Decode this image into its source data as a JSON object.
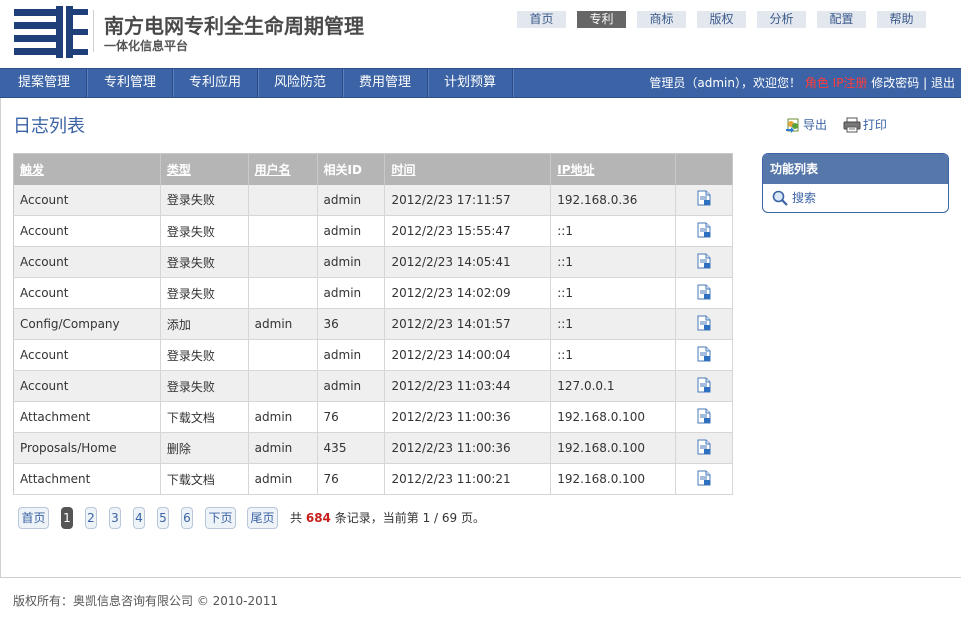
{
  "header": {
    "title": "南方电网专利全生命周期管理",
    "subtitle": "一体化信息平台"
  },
  "topnav": [
    {
      "label": "首页",
      "active": false
    },
    {
      "label": "专利",
      "active": true
    },
    {
      "label": "商标",
      "active": false
    },
    {
      "label": "版权",
      "active": false
    },
    {
      "label": "分析",
      "active": false
    },
    {
      "label": "配置",
      "active": false
    },
    {
      "label": "帮助",
      "active": false
    }
  ],
  "mainnav": [
    "提案管理",
    "专利管理",
    "专利应用",
    "风险防范",
    "费用管理",
    "计划预算"
  ],
  "userbar": {
    "greeting": "管理员（admin），欢迎您！",
    "red1": "角色",
    "red2": "IP注册",
    "change_password": "修改密码",
    "sep": "|",
    "logout": "退出"
  },
  "page": {
    "title": "日志列表",
    "export": "导出",
    "print": "打印"
  },
  "table": {
    "headers": [
      "触发",
      "类型",
      "用户名",
      "相关ID",
      "时间",
      "IP地址",
      ""
    ],
    "rows": [
      [
        "Account",
        "登录失败",
        "",
        "admin",
        "2012/2/23 17:11:57",
        "192.168.0.36"
      ],
      [
        "Account",
        "登录失败",
        "",
        "admin",
        "2012/2/23 15:55:47",
        "::1"
      ],
      [
        "Account",
        "登录失败",
        "",
        "admin",
        "2012/2/23 14:05:41",
        "::1"
      ],
      [
        "Account",
        "登录失败",
        "",
        "admin",
        "2012/2/23 14:02:09",
        "::1"
      ],
      [
        "Config/Company",
        "添加",
        "admin",
        "36",
        "2012/2/23 14:01:57",
        "::1"
      ],
      [
        "Account",
        "登录失败",
        "",
        "admin",
        "2012/2/23 14:00:04",
        "::1"
      ],
      [
        "Account",
        "登录失败",
        "",
        "admin",
        "2012/2/23 11:03:44",
        "127.0.0.1"
      ],
      [
        "Attachment",
        "下载文档",
        "admin",
        "76",
        "2012/2/23 11:00:36",
        "192.168.0.100"
      ],
      [
        "Proposals/Home",
        "删除",
        "admin",
        "435",
        "2012/2/23 11:00:36",
        "192.168.0.100"
      ],
      [
        "Attachment",
        "下载文档",
        "admin",
        "76",
        "2012/2/23 11:00:21",
        "192.168.0.100"
      ]
    ],
    "detail_icon": "document-detail-icon"
  },
  "pager": {
    "first": "首页",
    "pages": [
      "1",
      "2",
      "3",
      "4",
      "5",
      "6"
    ],
    "current": "1",
    "next": "下页",
    "last": "尾页",
    "info_prefix": "共",
    "total": "684",
    "info_mid": "条记录，当前第",
    "current_page": "1",
    "slash": "/",
    "total_pages": "69",
    "info_suffix": "页。"
  },
  "side": {
    "title": "功能列表",
    "items": [
      "搜索"
    ]
  },
  "footer": "版权所有：奥凯信息咨询有限公司 © 2010-2011",
  "colors": {
    "brand": "#3b63a5",
    "active_tab": "#666666",
    "total_highlight": "#c81e1e"
  }
}
